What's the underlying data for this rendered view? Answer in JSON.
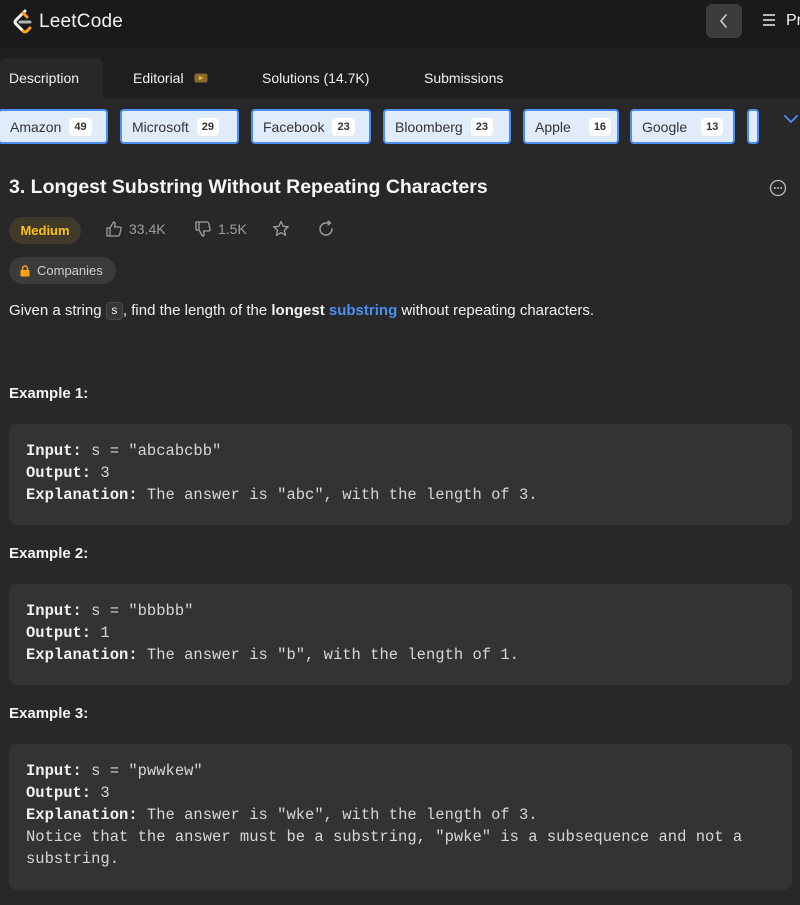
{
  "nav": {
    "logo_text": "LeetCode",
    "problems_label": "Pr"
  },
  "tabs": [
    {
      "label": "Description"
    },
    {
      "label": "Editorial"
    },
    {
      "label": "Solutions (14.7K)"
    },
    {
      "label": "Submissions"
    }
  ],
  "companies": [
    {
      "name": "Amazon",
      "count": "49"
    },
    {
      "name": "Microsoft",
      "count": "29"
    },
    {
      "name": "Facebook",
      "count": "23"
    },
    {
      "name": "Bloomberg",
      "count": "23"
    },
    {
      "name": "Apple",
      "count": "16"
    },
    {
      "name": "Google",
      "count": "13"
    }
  ],
  "problem": {
    "title": "3. Longest Substring Without Repeating Characters",
    "difficulty": "Medium",
    "likes": "33.4K",
    "dislikes": "1.5K",
    "companies_label": "Companies",
    "desc_pre": "Given a string ",
    "desc_code": "s",
    "desc_mid": ", find the length of the ",
    "desc_bold": "longest",
    "desc_link": "substring",
    "desc_post": " without repeating characters."
  },
  "examples": [
    {
      "title": "Example 1:",
      "input_label": "Input:",
      "input": " s = \"abcabcbb\"",
      "output_label": "Output:",
      "output": " 3",
      "explanation_label": "Explanation:",
      "explanation": " The answer is \"abc\", with the length of 3."
    },
    {
      "title": "Example 2:",
      "input_label": "Input:",
      "input": " s = \"bbbbb\"",
      "output_label": "Output:",
      "output": " 1",
      "explanation_label": "Explanation:",
      "explanation": " The answer is \"b\", with the length of 1."
    },
    {
      "title": "Example 3:",
      "input_label": "Input:",
      "input": " s = \"pwwkew\"",
      "output_label": "Output:",
      "output": " 3",
      "explanation_label": "Explanation:",
      "explanation": " The answer is \"wke\", with the length of 3.",
      "note_line1": "Notice that the answer must be a substring, \"pwke\" is a subsequence and not a",
      "note_line2": "substring."
    }
  ],
  "colors": {
    "accent": "#4b8ff0",
    "difficulty_medium": "#ffc01e",
    "chip_bg": "#e1ecfb",
    "chip_border": "#4d8ff5"
  },
  "icons": [
    "leetcode-logo-icon",
    "chevron-left-icon",
    "menu-icon",
    "video-icon",
    "chevron-down-icon",
    "more-icon",
    "thumbs-up-icon",
    "thumbs-down-icon",
    "star-icon",
    "share-icon",
    "lock-icon"
  ]
}
